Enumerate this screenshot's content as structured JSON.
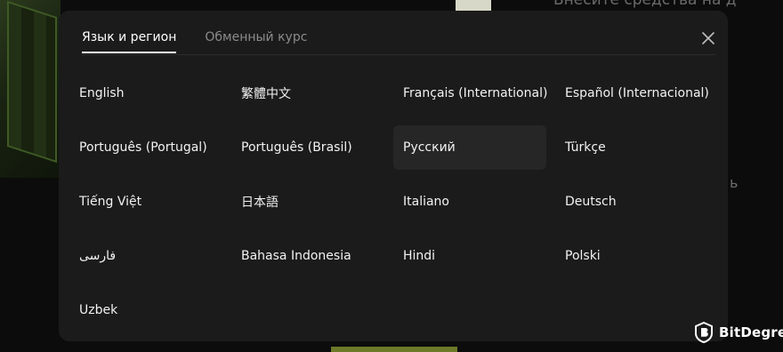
{
  "background": {
    "heading_fragment": "Внесите средства на д",
    "side_fragment": "ь"
  },
  "modal": {
    "tabs": [
      {
        "label": "Язык и регион",
        "active": true
      },
      {
        "label": "Обменный курс",
        "active": false
      }
    ],
    "close_icon": "close-icon",
    "selected_language": "Русский",
    "languages": [
      "English",
      "繁體中文",
      "Français (International)",
      "Español (Internacional)",
      "Português (Portugal)",
      "Português (Brasil)",
      "Русский",
      "Türkçe",
      "Tiếng Việt",
      "日本語",
      "Italiano",
      "Deutsch",
      "فارسی",
      "Bahasa Indonesia",
      "Hindi",
      "Polski",
      "Uzbek"
    ]
  },
  "watermark": {
    "text": "BitDegree",
    "icon": "bitdegree-logo-icon"
  },
  "colors": {
    "modal_bg": "#1b1b1b",
    "selected_bg": "#262626",
    "inactive_tab": "#8b8b8b",
    "text": "#f2f2f2"
  }
}
